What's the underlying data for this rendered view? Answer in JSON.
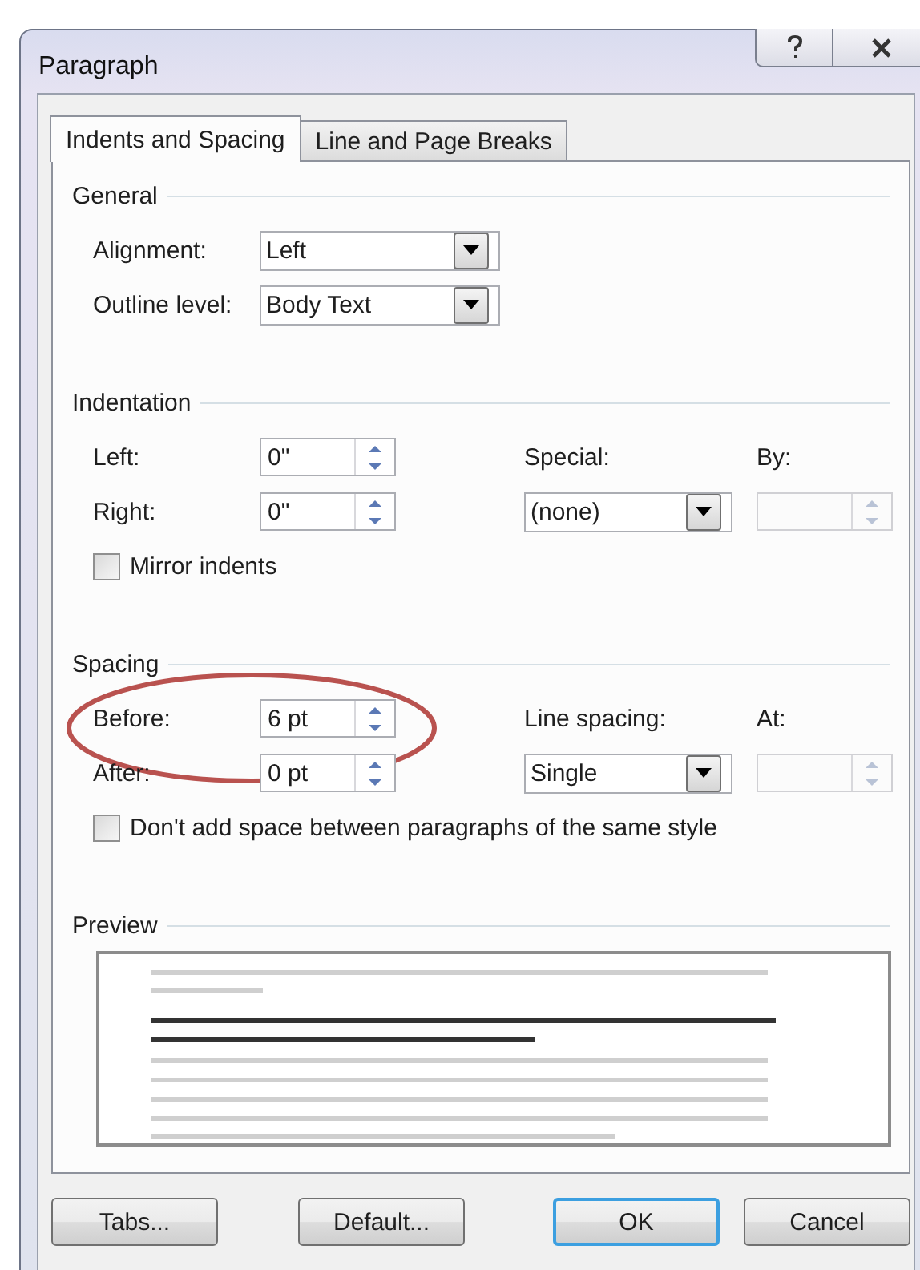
{
  "window": {
    "title": "Paragraph"
  },
  "tabs": [
    {
      "label": "Indents and Spacing",
      "selected": true
    },
    {
      "label": "Line and Page Breaks",
      "selected": false
    }
  ],
  "sections": [
    {
      "kind": "controls",
      "title": "General",
      "rows": [
        {
          "cells": [
            {
              "kind": "label",
              "text": "Alignment:"
            },
            {
              "kind": "dropdown",
              "value": "Left"
            }
          ]
        },
        {
          "cells": [
            {
              "kind": "label",
              "text": "Outline level:"
            },
            {
              "kind": "dropdown",
              "value": "Body Text"
            }
          ]
        }
      ]
    },
    {
      "kind": "controls",
      "title": "Indentation",
      "rows": [
        {
          "cells": [
            {
              "kind": "label",
              "text": "Left:"
            },
            {
              "kind": "spin",
              "value": "0\"",
              "disabled": false
            },
            {
              "kind": "label",
              "text": "Special:"
            },
            {
              "kind": "label",
              "text": "By:"
            }
          ]
        },
        {
          "cells": [
            {
              "kind": "label",
              "text": "Right:"
            },
            {
              "kind": "spin",
              "value": "0\"",
              "disabled": false
            },
            {
              "kind": "dropdown",
              "value": "(none)"
            },
            {
              "kind": "spin",
              "disabled": true
            }
          ]
        },
        {
          "cells": [
            {
              "kind": "checkbox",
              "text": "Mirror indents",
              "checked": false
            }
          ]
        }
      ]
    },
    {
      "kind": "controls",
      "title": "Spacing",
      "rows": [
        {
          "cells": [
            {
              "kind": "label",
              "text": "Before:"
            },
            {
              "kind": "spin",
              "value": "6 pt",
              "disabled": false,
              "circled": true
            },
            {
              "kind": "label",
              "text": "Line spacing:"
            },
            {
              "kind": "label",
              "text": "At:"
            }
          ]
        },
        {
          "cells": [
            {
              "kind": "label",
              "text": "After:"
            },
            {
              "kind": "spin",
              "value": "0 pt",
              "disabled": false
            },
            {
              "kind": "dropdown",
              "value": "Single"
            },
            {
              "kind": "spin",
              "disabled": true
            }
          ]
        },
        {
          "cells": [
            {
              "kind": "checkbox",
              "text": "Don't add space between paragraphs of the same style",
              "checked": false
            }
          ]
        }
      ]
    },
    {
      "kind": "preview",
      "title": "Preview"
    }
  ],
  "buttons": [
    {
      "label": "Tabs...",
      "focused": false
    },
    {
      "label": "Default...",
      "focused": false
    },
    {
      "label": "OK",
      "focused": true
    },
    {
      "label": "Cancel",
      "focused": false
    }
  ]
}
